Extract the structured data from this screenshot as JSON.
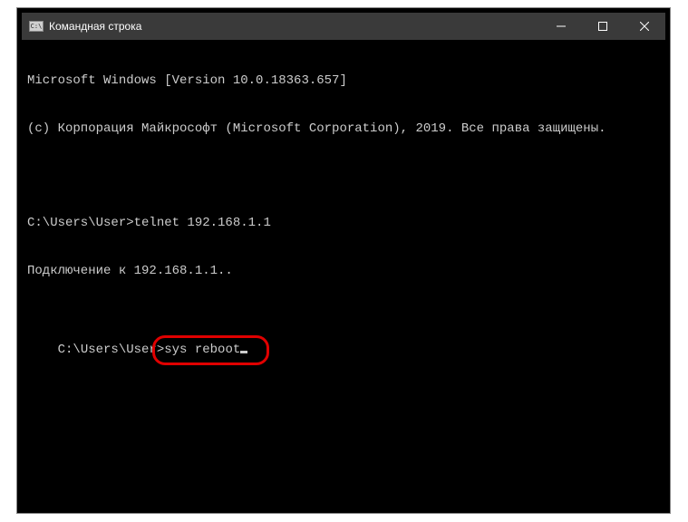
{
  "titlebar": {
    "icon_label": "C:\\",
    "title": "Командная строка"
  },
  "terminal": {
    "line1": "Microsoft Windows [Version 10.0.18363.657]",
    "line2": "(c) Корпорация Майкрософт (Microsoft Corporation), 2019. Все права защищены.",
    "line3": "C:\\Users\\User>telnet 192.168.1.1",
    "line4": "Подключение к 192.168.1.1..",
    "prompt": "C:\\Users\\User>",
    "command": "sys reboot"
  }
}
